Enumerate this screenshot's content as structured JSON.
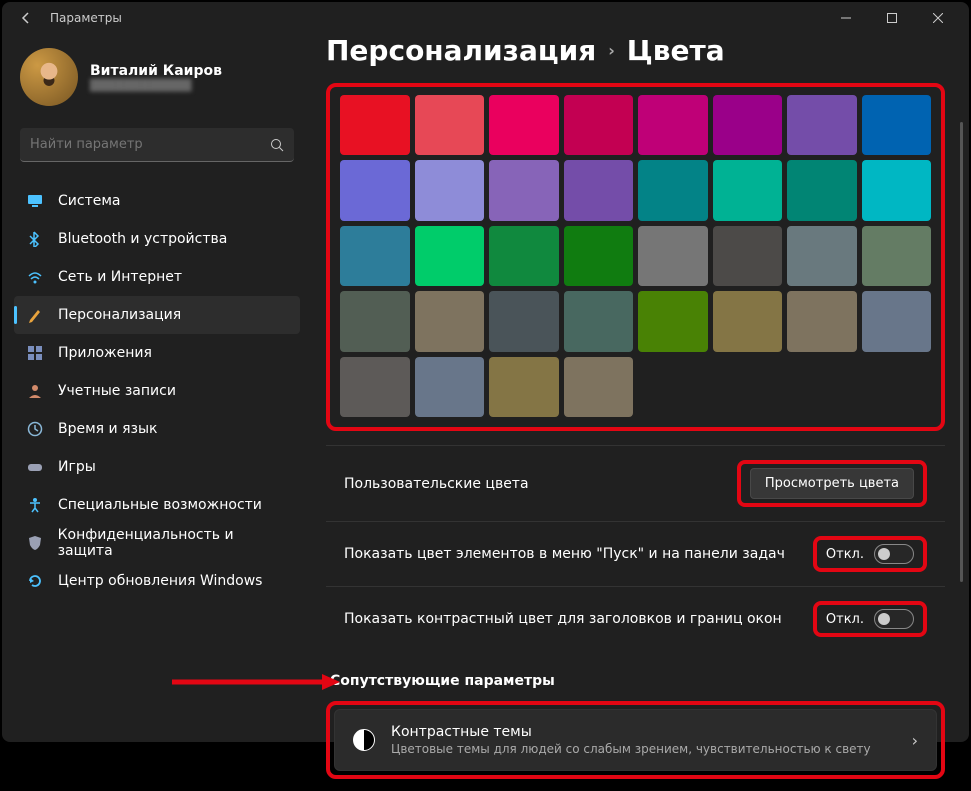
{
  "window": {
    "title": "Параметры"
  },
  "profile": {
    "name": "Виталий Каиров",
    "email": "████████████"
  },
  "search": {
    "placeholder": "Найти параметр"
  },
  "sidebar": {
    "items": [
      {
        "label": "Система",
        "icon": "monitor-icon",
        "color": "#0078d4"
      },
      {
        "label": "Bluetooth и устройства",
        "icon": "bluetooth-icon",
        "color": "#4cc2ff"
      },
      {
        "label": "Сеть и Интернет",
        "icon": "wifi-icon",
        "color": "#4cc2ff"
      },
      {
        "label": "Персонализация",
        "icon": "brush-icon",
        "color": "#e8a33d",
        "active": true
      },
      {
        "label": "Приложения",
        "icon": "apps-icon",
        "color": "#7a8ebd"
      },
      {
        "label": "Учетные записи",
        "icon": "person-icon",
        "color": "#d28a6a"
      },
      {
        "label": "Время и язык",
        "icon": "clock-icon",
        "color": "#8ab8d8"
      },
      {
        "label": "Игры",
        "icon": "gamepad-icon",
        "color": "#9aa0b4"
      },
      {
        "label": "Специальные возможности",
        "icon": "accessibility-icon",
        "color": "#4cc2ff"
      },
      {
        "label": "Конфиденциальность и защита",
        "icon": "shield-icon",
        "color": "#9aa0b4"
      },
      {
        "label": "Центр обновления Windows",
        "icon": "update-icon",
        "color": "#4cc2ff"
      }
    ]
  },
  "breadcrumb": {
    "parent": "Персонализация",
    "current": "Цвета"
  },
  "swatches": [
    "#e81123",
    "#e74856",
    "#ea005e",
    "#c30052",
    "#bf0077",
    "#9a0089",
    "#744da9",
    "#0063b1",
    "#6b69d6",
    "#8e8cd8",
    "#8764b8",
    "#744da9",
    "#038387",
    "#00b294",
    "#018574",
    "#00b7c3",
    "#2d7d9a",
    "#00cc6a",
    "#10893e",
    "#107c10",
    "#767676",
    "#4c4a48",
    "#69797e",
    "#647c64",
    "#525e54",
    "#7e735f",
    "#4a5459",
    "#486860",
    "#498205",
    "#847545",
    "#7e735f",
    "#68768a",
    "#5d5a58",
    "#68768a",
    "#847545",
    "#7e735f"
  ],
  "rows": {
    "custom": {
      "label": "Пользовательские цвета",
      "button": "Просмотреть цвета"
    },
    "start": {
      "label": "Показать цвет элементов в меню \"Пуск\" и на панели задач",
      "state": "Откл."
    },
    "title": {
      "label": "Показать контрастный цвет для заголовков и границ окон",
      "state": "Откл."
    }
  },
  "related": {
    "header": "Сопутствующие параметры",
    "card": {
      "title": "Контрастные темы",
      "sub": "Цветовые темы для людей со слабым зрением, чувствительностью к свету"
    }
  }
}
